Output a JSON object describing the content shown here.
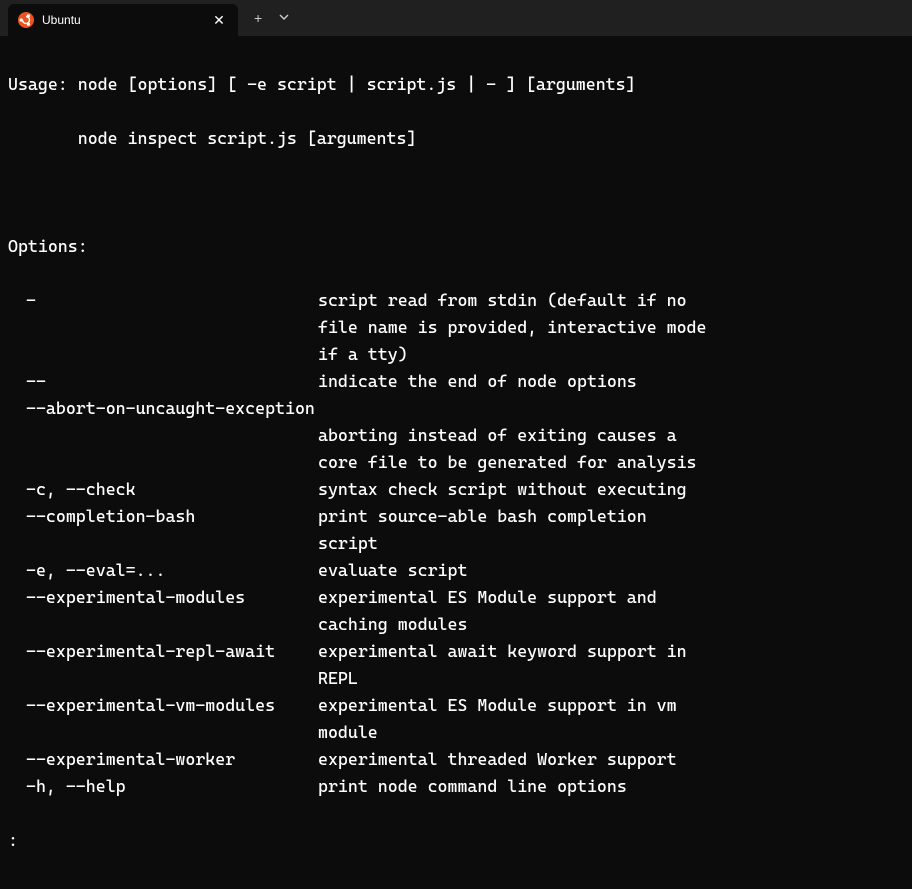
{
  "tab": {
    "title": "Ubuntu"
  },
  "usage": {
    "line1": "Usage: node [options] [ -e script | script.js | - ] [arguments]",
    "line2": "       node inspect script.js [arguments]"
  },
  "options_header": "Options:",
  "options": [
    {
      "flag": "-",
      "desc": [
        "script read from stdin (default if no",
        "file name is provided, interactive mode",
        "if a tty)"
      ]
    },
    {
      "flag": "--",
      "desc": [
        "indicate the end of node options"
      ]
    },
    {
      "flag": "--abort-on-uncaught-exception",
      "desc": [
        "",
        "aborting instead of exiting causes a",
        "core file to be generated for analysis"
      ]
    },
    {
      "flag": "-c, --check",
      "desc": [
        "syntax check script without executing"
      ]
    },
    {
      "flag": "--completion-bash",
      "desc": [
        "print source-able bash completion",
        "script"
      ]
    },
    {
      "flag": "-e, --eval=...",
      "desc": [
        "evaluate script"
      ]
    },
    {
      "flag": "--experimental-modules",
      "desc": [
        "experimental ES Module support and",
        "caching modules"
      ]
    },
    {
      "flag": "--experimental-repl-await",
      "desc": [
        "experimental await keyword support in",
        "REPL"
      ]
    },
    {
      "flag": "--experimental-vm-modules",
      "desc": [
        "experimental ES Module support in vm",
        "module"
      ]
    },
    {
      "flag": "--experimental-worker",
      "desc": [
        "experimental threaded Worker support"
      ]
    },
    {
      "flag": "-h, --help",
      "desc": [
        "print node command line options"
      ]
    }
  ],
  "pager_prompt": ":"
}
